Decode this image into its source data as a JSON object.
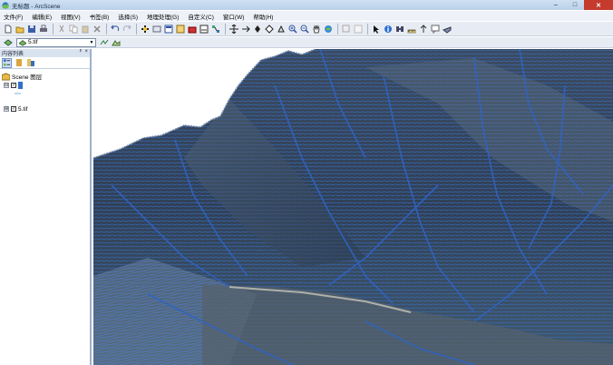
{
  "window": {
    "title": "无标题 - ArcScene",
    "min_label": "–",
    "max_label": "□",
    "close_label": "✕"
  },
  "menu": {
    "items": [
      "文件(F)",
      "编辑(E)",
      "视图(V)",
      "书签(B)",
      "选择(S)",
      "地理处理(G)",
      "自定义(C)",
      "窗口(W)",
      "帮助(H)"
    ]
  },
  "toolbar2": {
    "selected_layer": "5.tif",
    "dropdown_arrow": "▼"
  },
  "toc": {
    "title": "内容列表",
    "pin": "ᵖ",
    "close": "×",
    "scene_layer": "Scene 图层",
    "layer1_label": "",
    "layer2_label": "5.tif",
    "expanded_symbol": "⊟",
    "collapsed_symbol": "⊞",
    "check_mark": "✓"
  },
  "colors": {
    "titlebar": "#b9d1ea",
    "toolbar": "#e7ecf4",
    "contour_blue": "#2f5fb3",
    "terrain_dark": "#2b3a4f"
  }
}
